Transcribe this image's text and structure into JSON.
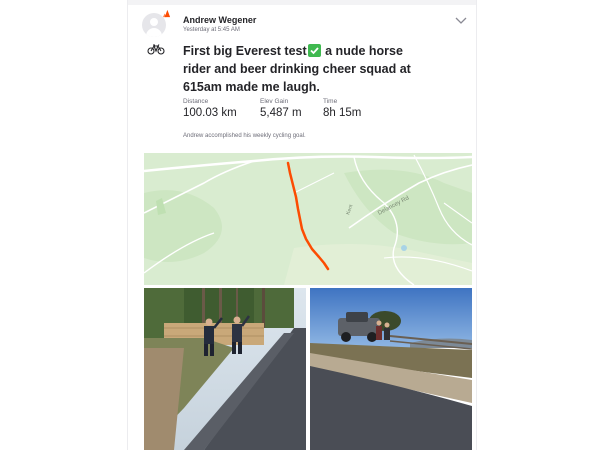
{
  "post": {
    "athlete_name": "Andrew Wegener",
    "timestamp": "Yesterday at 5:45 AM",
    "title_part1": "First big Everest test",
    "title_part2": " a nude horse rider and beer drinking cheer squad at 615am made me laugh.",
    "activity_type_icon": "bike-icon",
    "stats": [
      {
        "label": "Distance",
        "value": "100.03 km"
      },
      {
        "label": "Elev Gain",
        "value": "5,487 m"
      },
      {
        "label": "Time",
        "value": "8h 15m"
      }
    ],
    "goal_text": "Andrew accomplished his weekly cycling goal."
  },
  "map": {
    "road_labels": [
      "Delancey Rd",
      "Kent"
    ],
    "route_color": "#fc4c02"
  },
  "photos": [
    {
      "name": "photo-road-with-cyclists-cheering"
    },
    {
      "name": "photo-road-with-parked-ute"
    }
  ],
  "colors": {
    "brand": "#fc4c02",
    "check": "#3fb950",
    "map_bg": "#d9ecd0"
  }
}
